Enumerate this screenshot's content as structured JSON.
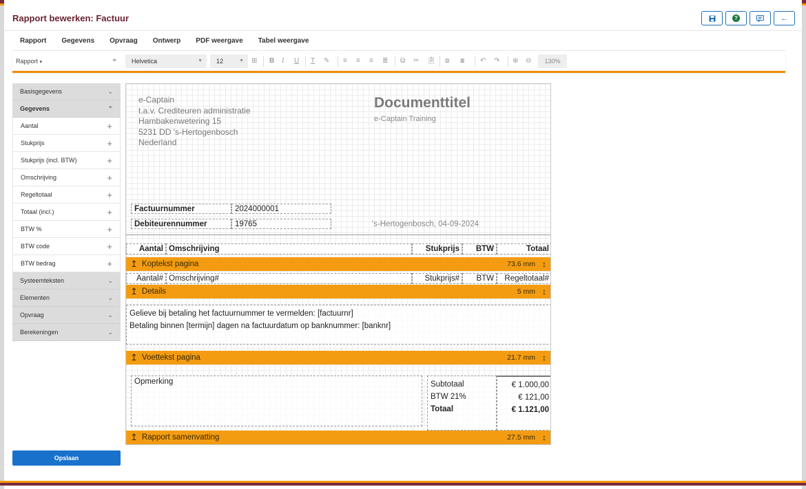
{
  "window": {
    "title": "Rapport bewerken: Factuur",
    "buttons": [
      {
        "name": "save-icon",
        "glyph": "💾"
      },
      {
        "name": "help-icon",
        "glyph": "?"
      },
      {
        "name": "comment-icon",
        "glyph": "▭"
      },
      {
        "name": "back-arrow-icon",
        "glyph": "←"
      }
    ]
  },
  "tabs": [
    "Rapport",
    "Gegevens",
    "Opvraag",
    "Ontwerp",
    "PDF weergave",
    "Tabel weergave"
  ],
  "active_tab": "Ontwerp",
  "toolbar": {
    "rapport_label": "Rapport",
    "font": "Helvetica",
    "size": "12",
    "zoom": "130%"
  },
  "sidebar": {
    "groups": [
      {
        "label": "Basisgegevens",
        "open": false
      },
      {
        "label": "Gegevens",
        "open": true,
        "items": [
          "Aantal",
          "Stukprijs",
          "Stukprijs (incl. BTW)",
          "Omschrijving",
          "Regeltotaal",
          "Totaal (incl.)",
          "BTW %",
          "BTW code",
          "BTW bedrag"
        ]
      },
      {
        "label": "Systeemteksten",
        "open": false
      },
      {
        "label": "Elementen",
        "open": false
      },
      {
        "label": "Opvraag",
        "open": false
      },
      {
        "label": "Berekeningen",
        "open": false
      }
    ],
    "save_label": "Opslaan"
  },
  "doc": {
    "address": [
      "e-Captain",
      "t.a.v. Crediteuren administratie",
      "Hambakenwetering 15",
      "5231 DD 's-Hertogenbosch",
      "Nederland"
    ],
    "title": "Documenttitel",
    "subtitle": "e-Captain Training",
    "invoice_label": "Factuurnummer",
    "invoice_value": "2024000001",
    "debtor_label": "Debiteurennummer",
    "debtor_value": "19765",
    "date": "'s-Hertogenbosch, 04-09-2024",
    "header_cols": [
      "Aantal",
      "Omschrijving",
      "Stukprijs",
      "BTW",
      "Totaal"
    ],
    "detail_cols": [
      "Aantal#",
      "Omschrijving#",
      "Stukprijs#",
      "BTW",
      "Regeltotaal#"
    ],
    "bands": {
      "header": {
        "label": "Koptekst pagina",
        "mm": "73.6 mm"
      },
      "details": {
        "label": "Details",
        "mm": "5 mm"
      },
      "footer": {
        "label": "Voettekst pagina",
        "mm": "21.7 mm"
      },
      "summary": {
        "label": "Rapport samenvatting",
        "mm": "27.5 mm"
      }
    },
    "payment_lines": [
      "Gelieve bij betaling het factuurnummer te vermelden: [factuurnr]",
      "Betaling binnen [termijn] dagen na factuurdatum op banknummer: [banknr]"
    ],
    "remark_label": "Opmerking",
    "totals": [
      {
        "label": "Subtotaal",
        "value": "€ 1.000,00"
      },
      {
        "label": "BTW 21%",
        "value": "€ 121,00"
      },
      {
        "label": "Totaal",
        "value": "€ 1.121,00"
      }
    ]
  }
}
